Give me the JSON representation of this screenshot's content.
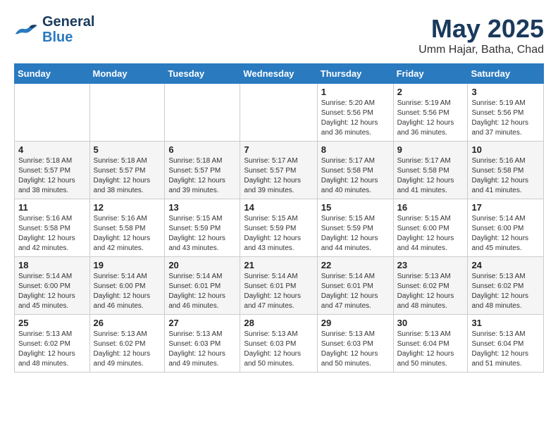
{
  "header": {
    "logo_line1": "General",
    "logo_line2": "Blue",
    "month": "May 2025",
    "location": "Umm Hajar, Batha, Chad"
  },
  "weekdays": [
    "Sunday",
    "Monday",
    "Tuesday",
    "Wednesday",
    "Thursday",
    "Friday",
    "Saturday"
  ],
  "weeks": [
    [
      {
        "day": "",
        "content": ""
      },
      {
        "day": "",
        "content": ""
      },
      {
        "day": "",
        "content": ""
      },
      {
        "day": "",
        "content": ""
      },
      {
        "day": "1",
        "content": "Sunrise: 5:20 AM\nSunset: 5:56 PM\nDaylight: 12 hours\nand 36 minutes."
      },
      {
        "day": "2",
        "content": "Sunrise: 5:19 AM\nSunset: 5:56 PM\nDaylight: 12 hours\nand 36 minutes."
      },
      {
        "day": "3",
        "content": "Sunrise: 5:19 AM\nSunset: 5:56 PM\nDaylight: 12 hours\nand 37 minutes."
      }
    ],
    [
      {
        "day": "4",
        "content": "Sunrise: 5:18 AM\nSunset: 5:57 PM\nDaylight: 12 hours\nand 38 minutes."
      },
      {
        "day": "5",
        "content": "Sunrise: 5:18 AM\nSunset: 5:57 PM\nDaylight: 12 hours\nand 38 minutes."
      },
      {
        "day": "6",
        "content": "Sunrise: 5:18 AM\nSunset: 5:57 PM\nDaylight: 12 hours\nand 39 minutes."
      },
      {
        "day": "7",
        "content": "Sunrise: 5:17 AM\nSunset: 5:57 PM\nDaylight: 12 hours\nand 39 minutes."
      },
      {
        "day": "8",
        "content": "Sunrise: 5:17 AM\nSunset: 5:58 PM\nDaylight: 12 hours\nand 40 minutes."
      },
      {
        "day": "9",
        "content": "Sunrise: 5:17 AM\nSunset: 5:58 PM\nDaylight: 12 hours\nand 41 minutes."
      },
      {
        "day": "10",
        "content": "Sunrise: 5:16 AM\nSunset: 5:58 PM\nDaylight: 12 hours\nand 41 minutes."
      }
    ],
    [
      {
        "day": "11",
        "content": "Sunrise: 5:16 AM\nSunset: 5:58 PM\nDaylight: 12 hours\nand 42 minutes."
      },
      {
        "day": "12",
        "content": "Sunrise: 5:16 AM\nSunset: 5:58 PM\nDaylight: 12 hours\nand 42 minutes."
      },
      {
        "day": "13",
        "content": "Sunrise: 5:15 AM\nSunset: 5:59 PM\nDaylight: 12 hours\nand 43 minutes."
      },
      {
        "day": "14",
        "content": "Sunrise: 5:15 AM\nSunset: 5:59 PM\nDaylight: 12 hours\nand 43 minutes."
      },
      {
        "day": "15",
        "content": "Sunrise: 5:15 AM\nSunset: 5:59 PM\nDaylight: 12 hours\nand 44 minutes."
      },
      {
        "day": "16",
        "content": "Sunrise: 5:15 AM\nSunset: 6:00 PM\nDaylight: 12 hours\nand 44 minutes."
      },
      {
        "day": "17",
        "content": "Sunrise: 5:14 AM\nSunset: 6:00 PM\nDaylight: 12 hours\nand 45 minutes."
      }
    ],
    [
      {
        "day": "18",
        "content": "Sunrise: 5:14 AM\nSunset: 6:00 PM\nDaylight: 12 hours\nand 45 minutes."
      },
      {
        "day": "19",
        "content": "Sunrise: 5:14 AM\nSunset: 6:00 PM\nDaylight: 12 hours\nand 46 minutes."
      },
      {
        "day": "20",
        "content": "Sunrise: 5:14 AM\nSunset: 6:01 PM\nDaylight: 12 hours\nand 46 minutes."
      },
      {
        "day": "21",
        "content": "Sunrise: 5:14 AM\nSunset: 6:01 PM\nDaylight: 12 hours\nand 47 minutes."
      },
      {
        "day": "22",
        "content": "Sunrise: 5:14 AM\nSunset: 6:01 PM\nDaylight: 12 hours\nand 47 minutes."
      },
      {
        "day": "23",
        "content": "Sunrise: 5:13 AM\nSunset: 6:02 PM\nDaylight: 12 hours\nand 48 minutes."
      },
      {
        "day": "24",
        "content": "Sunrise: 5:13 AM\nSunset: 6:02 PM\nDaylight: 12 hours\nand 48 minutes."
      }
    ],
    [
      {
        "day": "25",
        "content": "Sunrise: 5:13 AM\nSunset: 6:02 PM\nDaylight: 12 hours\nand 48 minutes."
      },
      {
        "day": "26",
        "content": "Sunrise: 5:13 AM\nSunset: 6:02 PM\nDaylight: 12 hours\nand 49 minutes."
      },
      {
        "day": "27",
        "content": "Sunrise: 5:13 AM\nSunset: 6:03 PM\nDaylight: 12 hours\nand 49 minutes."
      },
      {
        "day": "28",
        "content": "Sunrise: 5:13 AM\nSunset: 6:03 PM\nDaylight: 12 hours\nand 50 minutes."
      },
      {
        "day": "29",
        "content": "Sunrise: 5:13 AM\nSunset: 6:03 PM\nDaylight: 12 hours\nand 50 minutes."
      },
      {
        "day": "30",
        "content": "Sunrise: 5:13 AM\nSunset: 6:04 PM\nDaylight: 12 hours\nand 50 minutes."
      },
      {
        "day": "31",
        "content": "Sunrise: 5:13 AM\nSunset: 6:04 PM\nDaylight: 12 hours\nand 51 minutes."
      }
    ]
  ]
}
